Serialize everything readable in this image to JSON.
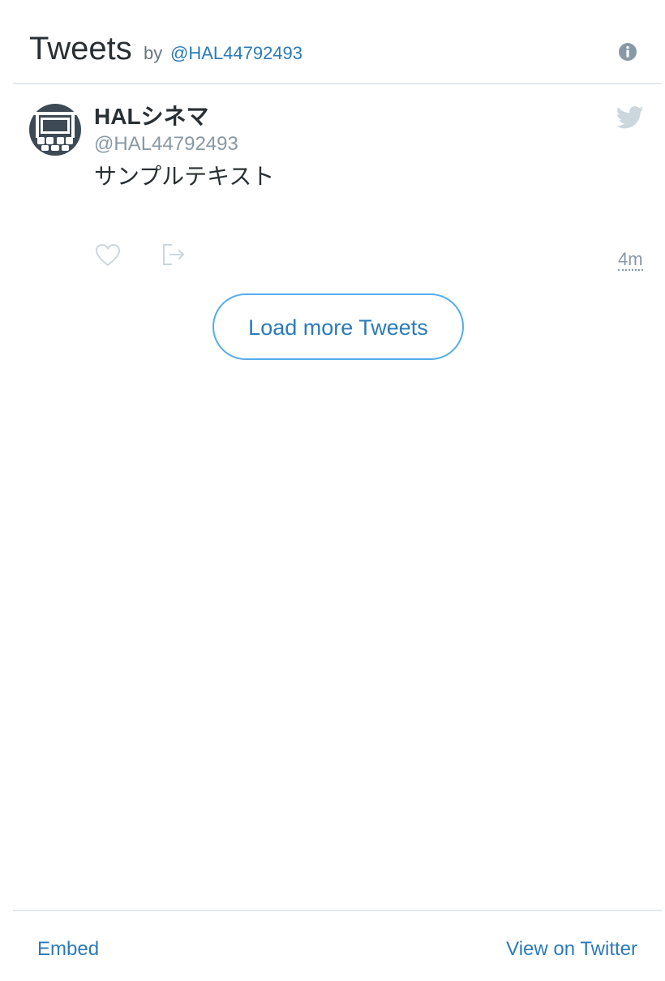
{
  "header": {
    "title": "Tweets",
    "by": "by",
    "handle": "@HAL44792493"
  },
  "tweet": {
    "name": "HALシネマ",
    "handle": "@HAL44792493",
    "text": "サンプルテキスト",
    "timestamp": "4m"
  },
  "load_more": {
    "label": "Load more Tweets"
  },
  "footer": {
    "embed": "Embed",
    "view_on_twitter": "View on Twitter"
  },
  "colors": {
    "link": "#2b7bb9",
    "accent_border": "#55acee",
    "muted": "#8899a6",
    "text": "#292f33",
    "divider": "#e1e8ed",
    "icon_light": "#ccd6dd"
  },
  "icons": {
    "info": "info-icon",
    "avatar": "cinema-avatar-icon",
    "bird": "twitter-bird-icon",
    "heart": "heart-icon",
    "share": "share-icon"
  }
}
